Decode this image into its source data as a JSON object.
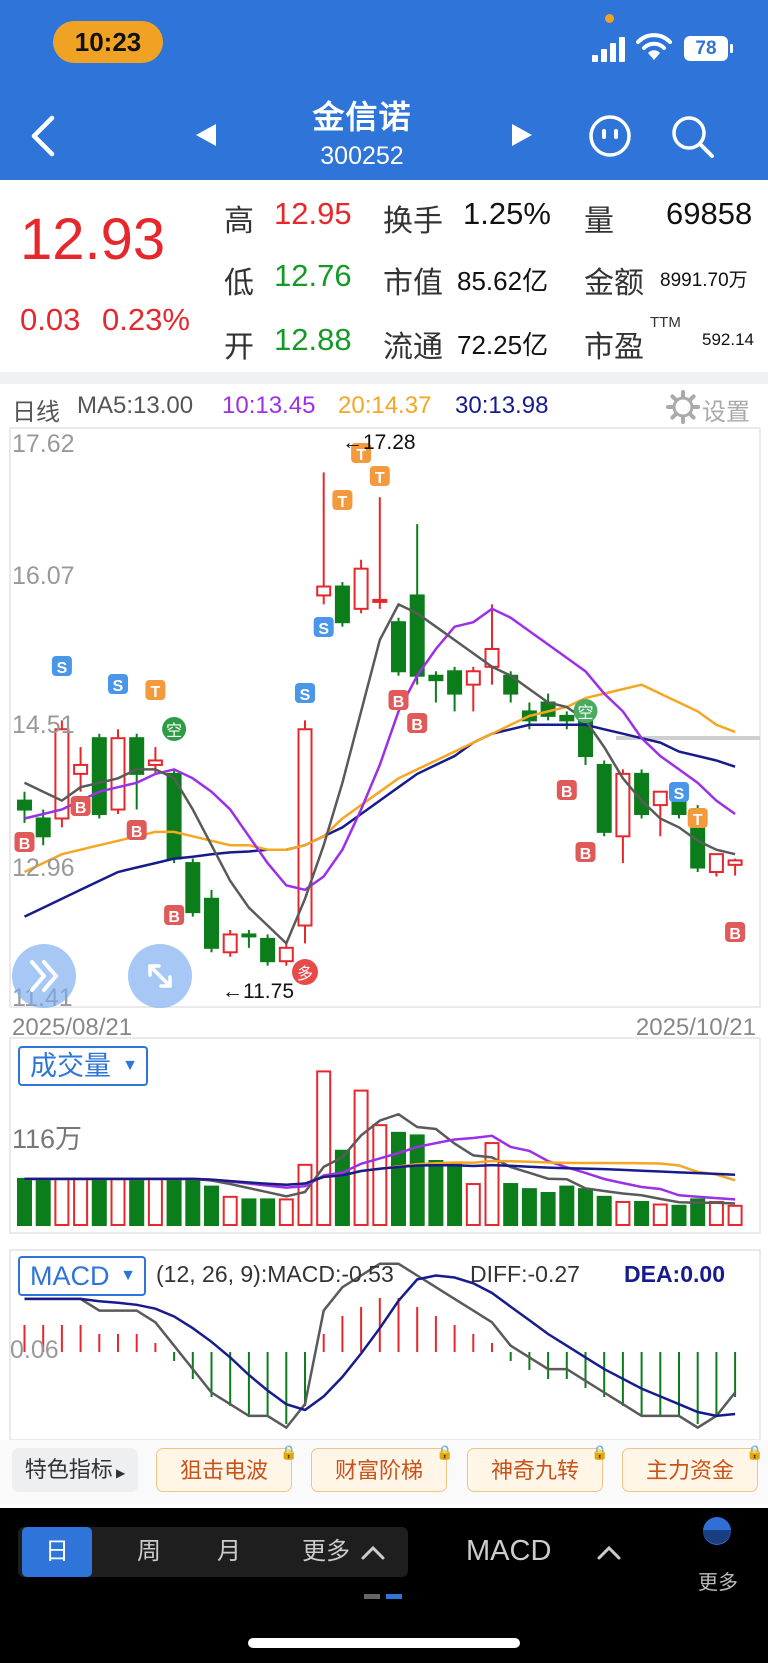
{
  "status": {
    "time": "10:23",
    "battery": "78"
  },
  "header": {
    "name": "金信诺",
    "code": "300252"
  },
  "quote": {
    "price": "12.93",
    "change": "0.03",
    "change_pct": "0.23%",
    "rows": [
      [
        {
          "l": "高",
          "v": "12.95"
        },
        {
          "l": "换手",
          "v": "1.25%"
        },
        {
          "l": "量",
          "v": "69858"
        }
      ],
      [
        {
          "l": "低",
          "v": "12.76"
        },
        {
          "l": "市值",
          "v": "85.62亿"
        },
        {
          "l": "金额",
          "v": "8991.70万"
        }
      ],
      [
        {
          "l": "开",
          "v": "12.88"
        },
        {
          "l": "流通",
          "v": "72.25亿"
        },
        {
          "l": "市盈",
          "v": "592.14",
          "sup": "TTM"
        }
      ]
    ]
  },
  "ma": {
    "period": "日线",
    "ma5": "MA5:13.00",
    "ma10": "10:13.45",
    "ma20": "20:14.37",
    "ma30": "30:13.98",
    "settings": "设置"
  },
  "colors": {
    "up": "#e6272c",
    "down": "#0b7d1b",
    "ma5": "#5a5a5a",
    "ma10": "#9b30e8",
    "ma20": "#f5a623",
    "ma30": "#161c8c",
    "accent": "#2f74d8"
  },
  "kline": {
    "y_labels": [
      "17.62",
      "16.07",
      "14.51",
      "12.96",
      "11.41"
    ],
    "date_start": "2025/08/21",
    "date_end": "2025/10/21",
    "high_label": "←17.28",
    "low_label": "←11.75"
  },
  "volume": {
    "label": "成交量",
    "y_label": "116万"
  },
  "macd": {
    "label": "MACD",
    "params": "(12, 26, 9):MACD:-0.53",
    "diff": "DIFF:-0.27",
    "dea": "DEA:0.00",
    "y_label": "0.06"
  },
  "features": {
    "label": "特色指标",
    "items": [
      "狙击电波",
      "财富阶梯",
      "神奇九转",
      "主力资金"
    ]
  },
  "bottom": {
    "periods": [
      "日",
      "周",
      "月",
      "更多"
    ],
    "indicator": "MACD",
    "more": "更多"
  },
  "chart_data": {
    "type": "candlestick",
    "x_range": [
      "2025/08/21",
      "2025/10/21"
    ],
    "ylim": [
      11.41,
      17.62
    ],
    "candles": [
      {
        "o": 13.6,
        "h": 13.7,
        "l": 13.35,
        "c": 13.5
      },
      {
        "o": 13.4,
        "h": 13.5,
        "l": 13.1,
        "c": 13.2
      },
      {
        "o": 13.4,
        "h": 14.5,
        "l": 13.3,
        "c": 14.4
      },
      {
        "o": 13.9,
        "h": 14.2,
        "l": 13.7,
        "c": 14.0
      },
      {
        "o": 14.3,
        "h": 14.35,
        "l": 13.4,
        "c": 13.45
      },
      {
        "o": 13.5,
        "h": 14.4,
        "l": 13.45,
        "c": 14.3
      },
      {
        "o": 14.3,
        "h": 14.35,
        "l": 13.5,
        "c": 13.9
      },
      {
        "o": 14.0,
        "h": 14.2,
        "l": 13.9,
        "c": 14.05
      },
      {
        "o": 13.9,
        "h": 13.95,
        "l": 12.9,
        "c": 12.95
      },
      {
        "o": 12.9,
        "h": 12.95,
        "l": 12.3,
        "c": 12.35
      },
      {
        "o": 12.5,
        "h": 12.6,
        "l": 11.9,
        "c": 11.95
      },
      {
        "o": 11.9,
        "h": 12.15,
        "l": 11.85,
        "c": 12.1
      },
      {
        "o": 12.1,
        "h": 12.15,
        "l": 11.95,
        "c": 12.08
      },
      {
        "o": 12.05,
        "h": 12.1,
        "l": 11.75,
        "c": 11.8
      },
      {
        "o": 11.8,
        "h": 12.0,
        "l": 11.75,
        "c": 11.95
      },
      {
        "o": 12.2,
        "h": 14.5,
        "l": 12.0,
        "c": 14.4
      },
      {
        "o": 15.9,
        "h": 17.28,
        "l": 15.8,
        "c": 16.0
      },
      {
        "o": 16.0,
        "h": 16.05,
        "l": 15.55,
        "c": 15.6
      },
      {
        "o": 15.75,
        "h": 16.3,
        "l": 15.7,
        "c": 16.2
      },
      {
        "o": 15.85,
        "h": 17.0,
        "l": 15.75,
        "c": 15.85
      },
      {
        "o": 15.6,
        "h": 15.65,
        "l": 15.0,
        "c": 15.05
      },
      {
        "o": 15.9,
        "h": 16.7,
        "l": 14.9,
        "c": 15.0
      },
      {
        "o": 15.0,
        "h": 15.05,
        "l": 14.7,
        "c": 14.95
      },
      {
        "o": 15.05,
        "h": 15.1,
        "l": 14.6,
        "c": 14.8
      },
      {
        "o": 14.9,
        "h": 15.1,
        "l": 14.6,
        "c": 15.05
      },
      {
        "o": 15.1,
        "h": 15.8,
        "l": 14.9,
        "c": 15.3
      },
      {
        "o": 15.0,
        "h": 15.05,
        "l": 14.7,
        "c": 14.8
      },
      {
        "o": 14.6,
        "h": 14.7,
        "l": 14.4,
        "c": 14.5
      },
      {
        "o": 14.7,
        "h": 14.8,
        "l": 14.5,
        "c": 14.55
      },
      {
        "o": 14.55,
        "h": 14.6,
        "l": 14.4,
        "c": 14.5
      },
      {
        "o": 14.5,
        "h": 14.6,
        "l": 14.0,
        "c": 14.1
      },
      {
        "o": 14.0,
        "h": 14.05,
        "l": 13.2,
        "c": 13.25
      },
      {
        "o": 13.2,
        "h": 13.95,
        "l": 12.9,
        "c": 13.9
      },
      {
        "o": 13.9,
        "h": 13.95,
        "l": 13.4,
        "c": 13.45
      },
      {
        "o": 13.55,
        "h": 13.7,
        "l": 13.2,
        "c": 13.7
      },
      {
        "o": 13.7,
        "h": 13.75,
        "l": 13.4,
        "c": 13.45
      },
      {
        "o": 13.5,
        "h": 13.55,
        "l": 12.8,
        "c": 12.85
      },
      {
        "o": 12.8,
        "h": 13.0,
        "l": 12.75,
        "c": 13.0
      },
      {
        "o": 12.88,
        "h": 12.95,
        "l": 12.76,
        "c": 12.93
      }
    ],
    "ma5": [
      13.8,
      13.7,
      13.6,
      13.75,
      13.8,
      13.85,
      13.95,
      13.95,
      13.85,
      13.5,
      13.1,
      12.7,
      12.4,
      12.2,
      12.0,
      12.5,
      13.1,
      13.8,
      14.6,
      15.4,
      15.8,
      15.7,
      15.55,
      15.4,
      15.25,
      15.1,
      15.0,
      14.85,
      14.7,
      14.65,
      14.5,
      14.2,
      13.85,
      13.6,
      13.4,
      13.3,
      13.15,
      13.05,
      13.0
    ],
    "ma10": [
      13.4,
      13.45,
      13.5,
      13.6,
      13.7,
      13.75,
      13.8,
      13.9,
      13.95,
      13.85,
      13.7,
      13.5,
      13.2,
      12.9,
      12.65,
      12.6,
      12.75,
      13.05,
      13.5,
      14.0,
      14.6,
      15.0,
      15.3,
      15.55,
      15.6,
      15.75,
      15.65,
      15.5,
      15.35,
      15.2,
      15.05,
      14.8,
      14.6,
      14.3,
      14.1,
      13.95,
      13.8,
      13.6,
      13.45
    ],
    "ma20": [
      12.8,
      12.9,
      13.0,
      13.05,
      13.1,
      13.15,
      13.2,
      13.25,
      13.25,
      13.2,
      13.15,
      13.1,
      13.1,
      13.05,
      13.05,
      13.1,
      13.2,
      13.4,
      13.55,
      13.7,
      13.85,
      13.95,
      14.05,
      14.15,
      14.25,
      14.35,
      14.45,
      14.55,
      14.6,
      14.65,
      14.75,
      14.8,
      14.85,
      14.9,
      14.8,
      14.7,
      14.6,
      14.45,
      14.37
    ],
    "ma30": [
      12.3,
      12.4,
      12.5,
      12.6,
      12.7,
      12.8,
      12.85,
      12.9,
      12.95,
      12.97,
      13.0,
      13.02,
      13.03,
      13.05,
      13.05,
      13.1,
      13.2,
      13.3,
      13.45,
      13.6,
      13.75,
      13.9,
      14.0,
      14.1,
      14.25,
      14.35,
      14.4,
      14.45,
      14.45,
      14.45,
      14.45,
      14.4,
      14.35,
      14.3,
      14.25,
      14.15,
      14.1,
      14.05,
      13.98
    ],
    "volume": [
      0.36,
      0.36,
      0.36,
      0.36,
      0.36,
      0.36,
      0.36,
      0.36,
      0.36,
      0.36,
      0.3,
      0.22,
      0.2,
      0.2,
      0.2,
      0.47,
      1.2,
      0.58,
      1.05,
      0.78,
      0.72,
      0.7,
      0.5,
      0.48,
      0.32,
      0.64,
      0.32,
      0.28,
      0.25,
      0.3,
      0.28,
      0.22,
      0.18,
      0.18,
      0.16,
      0.15,
      0.2,
      0.18,
      0.15
    ],
    "macd_hist": [
      0.03,
      0.03,
      0.03,
      0.03,
      0.02,
      0.02,
      0.02,
      0.01,
      -0.01,
      -0.03,
      -0.05,
      -0.06,
      -0.07,
      -0.07,
      -0.08,
      -0.06,
      0.02,
      0.04,
      0.05,
      0.06,
      0.06,
      0.05,
      0.04,
      0.03,
      0.02,
      0.01,
      -0.01,
      -0.02,
      -0.03,
      -0.03,
      -0.04,
      -0.05,
      -0.06,
      -0.07,
      -0.07,
      -0.07,
      -0.08,
      -0.07,
      -0.05
    ]
  }
}
